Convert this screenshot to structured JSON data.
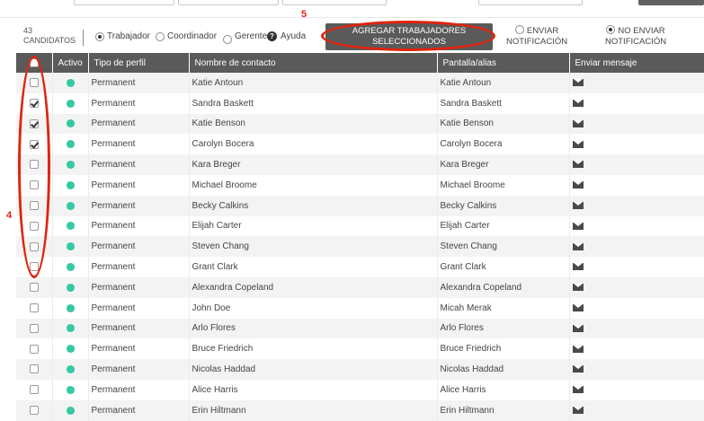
{
  "toolbar": {
    "count_number": "43",
    "count_label": "CANDIDATOS",
    "role_worker": "Trabajador",
    "role_coordinator": "Coordinador",
    "role_manager": "Gerente",
    "help_label": "Ayuda",
    "add_line1": "AGREGAR TRABAJADORES",
    "add_line2": "SELECCIONADOS",
    "notify_send_line1": "ENVIAR",
    "notify_send_line2": "NOTIFICACIÓN",
    "notify_nosend_line1": "NO ENVIAR",
    "notify_nosend_line2": "NOTIFICACIÓN"
  },
  "annotations": {
    "step4": "4",
    "step5": "5",
    "color": "#e0240e"
  },
  "table": {
    "headers": [
      "Activo",
      "Tipo de perfil",
      "Nombre de contacto",
      "Pantalla/alias",
      "Enviar mensaje"
    ],
    "rows": [
      {
        "checked": false,
        "profile": "Permanent",
        "name": "Katie Antoun",
        "alias": "Katie Antoun"
      },
      {
        "checked": true,
        "profile": "Permanent",
        "name": "Sandra Baskett",
        "alias": "Sandra Baskett"
      },
      {
        "checked": true,
        "profile": "Permanent",
        "name": "Katie Benson",
        "alias": "Katie Benson"
      },
      {
        "checked": true,
        "profile": "Permanent",
        "name": "Carolyn Bocera",
        "alias": "Carolyn Bocera"
      },
      {
        "checked": false,
        "profile": "Permanent",
        "name": "Kara Breger",
        "alias": "Kara Breger"
      },
      {
        "checked": false,
        "profile": "Permanent",
        "name": "Michael Broome",
        "alias": "Michael Broome"
      },
      {
        "checked": false,
        "profile": "Permanent",
        "name": "Becky Calkins",
        "alias": "Becky Calkins"
      },
      {
        "checked": false,
        "profile": "Permanent",
        "name": "Elijah Carter",
        "alias": "Elijah Carter"
      },
      {
        "checked": false,
        "profile": "Permanent",
        "name": "Steven Chang",
        "alias": "Steven Chang"
      },
      {
        "checked": false,
        "profile": "Permanent",
        "name": "Grant Clark",
        "alias": "Grant Clark"
      },
      {
        "checked": false,
        "profile": "Permanent",
        "name": "Alexandra Copeland",
        "alias": "Alexandra Copeland"
      },
      {
        "checked": false,
        "profile": "Permanent",
        "name": "John Doe",
        "alias": "Micah Merak"
      },
      {
        "checked": false,
        "profile": "Permanent",
        "name": "Arlo Flores",
        "alias": "Arlo Flores"
      },
      {
        "checked": false,
        "profile": "Permanent",
        "name": "Bruce Friedrich",
        "alias": "Bruce Friedrich"
      },
      {
        "checked": false,
        "profile": "Permanent",
        "name": "Nicolas Haddad",
        "alias": "Nicolas Haddad"
      },
      {
        "checked": false,
        "profile": "Permanent",
        "name": "Alice Harris",
        "alias": "Alice Harris"
      },
      {
        "checked": false,
        "profile": "Permanent",
        "name": "Erin Hiltmann",
        "alias": "Erin Hiltmann"
      }
    ]
  },
  "colors": {
    "header_bg": "#5a5a5a",
    "active": "#35c9a3",
    "row_alt": "#f3f3f3"
  }
}
